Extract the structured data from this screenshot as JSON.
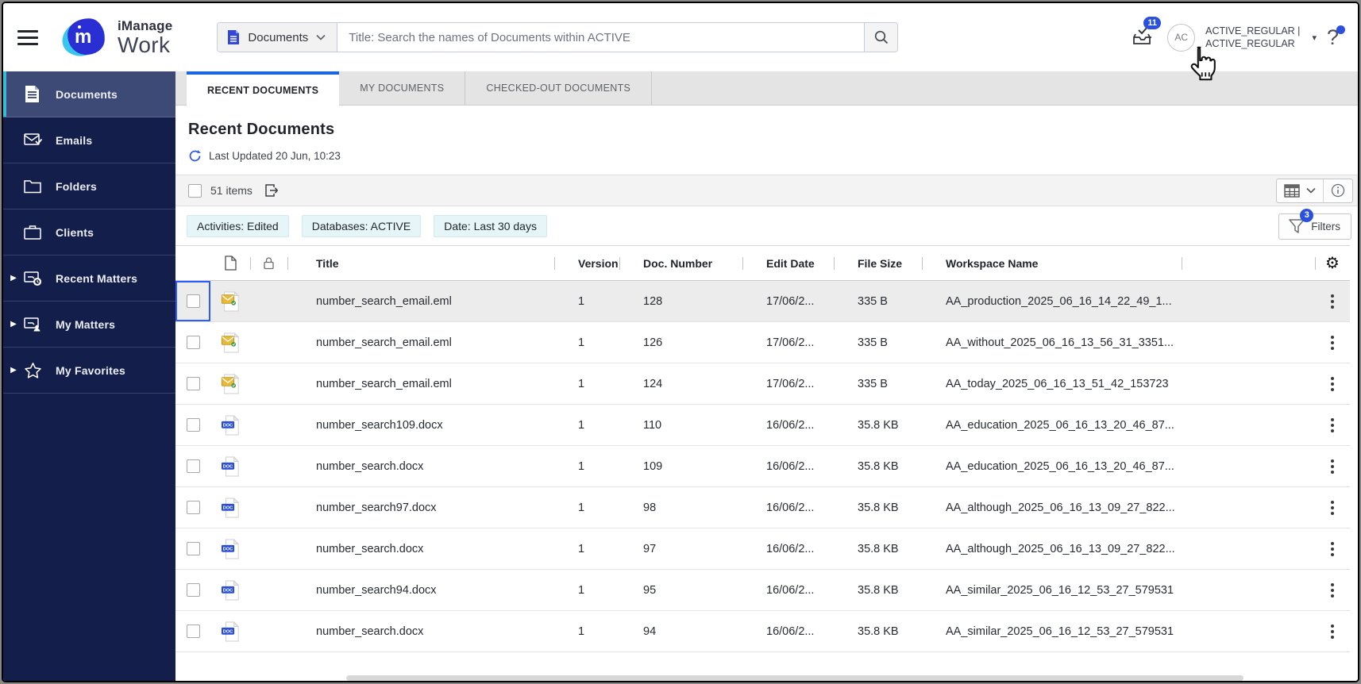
{
  "header": {
    "logo": {
      "line1": "iManage",
      "line2": "Work"
    },
    "search": {
      "scope": "Documents",
      "placeholder": "Title: Search the names of Documents within ACTIVE"
    },
    "notifications_count": "11",
    "user": {
      "initials": "AC",
      "line1": "ACTIVE_REGULAR |",
      "line2": "ACTIVE_REGULAR"
    },
    "help_glyph": "?"
  },
  "sidebar": {
    "items": [
      {
        "label": "Documents",
        "icon": "documents-icon",
        "active": true,
        "expandable": false
      },
      {
        "label": "Emails",
        "icon": "emails-icon",
        "active": false,
        "expandable": false
      },
      {
        "label": "Folders",
        "icon": "folders-icon",
        "active": false,
        "expandable": false
      },
      {
        "label": "Clients",
        "icon": "clients-icon",
        "active": false,
        "expandable": false
      },
      {
        "label": "Recent Matters",
        "icon": "recent-matters-icon",
        "active": false,
        "expandable": true
      },
      {
        "label": "My Matters",
        "icon": "my-matters-icon",
        "active": false,
        "expandable": true
      },
      {
        "label": "My Favorites",
        "icon": "favorites-star-icon",
        "active": false,
        "expandable": true
      }
    ]
  },
  "tabs": [
    {
      "label": "RECENT DOCUMENTS",
      "active": true
    },
    {
      "label": "MY DOCUMENTS",
      "active": false
    },
    {
      "label": "CHECKED-OUT DOCUMENTS",
      "active": false
    }
  ],
  "content": {
    "title": "Recent Documents",
    "last_updated": "Last Updated 20 Jun, 10:23",
    "items_count": "51 items",
    "filter_chips": [
      "Activities: Edited",
      "Databases: ACTIVE",
      "Date: Last 30 days"
    ],
    "filters": {
      "label": "Filters",
      "badge": "3"
    }
  },
  "table": {
    "columns": {
      "title": "Title",
      "version": "Version",
      "doc_number": "Doc. Number",
      "edit_date": "Edit Date",
      "file_size": "File Size",
      "workspace": "Workspace Name"
    },
    "rows": [
      {
        "type": "email",
        "title": "number_search_email.eml",
        "version": "1",
        "doc_number": "128",
        "edit_date": "17/06/2...",
        "file_size": "335 B",
        "workspace": "AA_production_2025_06_16_14_22_49_1...",
        "selected": true
      },
      {
        "type": "email",
        "title": "number_search_email.eml",
        "version": "1",
        "doc_number": "126",
        "edit_date": "17/06/2...",
        "file_size": "335 B",
        "workspace": "AA_without_2025_06_16_13_56_31_3351...",
        "selected": false
      },
      {
        "type": "email",
        "title": "number_search_email.eml",
        "version": "1",
        "doc_number": "124",
        "edit_date": "17/06/2...",
        "file_size": "335 B",
        "workspace": "AA_today_2025_06_16_13_51_42_153723",
        "selected": false
      },
      {
        "type": "doc",
        "title": "number_search109.docx",
        "version": "1",
        "doc_number": "110",
        "edit_date": "16/06/2...",
        "file_size": "35.8 KB",
        "workspace": "AA_education_2025_06_16_13_20_46_87...",
        "selected": false
      },
      {
        "type": "doc",
        "title": "number_search.docx",
        "version": "1",
        "doc_number": "109",
        "edit_date": "16/06/2...",
        "file_size": "35.8 KB",
        "workspace": "AA_education_2025_06_16_13_20_46_87...",
        "selected": false
      },
      {
        "type": "doc",
        "title": "number_search97.docx",
        "version": "1",
        "doc_number": "98",
        "edit_date": "16/06/2...",
        "file_size": "35.8 KB",
        "workspace": "AA_although_2025_06_16_13_09_27_822...",
        "selected": false
      },
      {
        "type": "doc",
        "title": "number_search.docx",
        "version": "1",
        "doc_number": "97",
        "edit_date": "16/06/2...",
        "file_size": "35.8 KB",
        "workspace": "AA_although_2025_06_16_13_09_27_822...",
        "selected": false
      },
      {
        "type": "doc",
        "title": "number_search94.docx",
        "version": "1",
        "doc_number": "95",
        "edit_date": "16/06/2...",
        "file_size": "35.8 KB",
        "workspace": "AA_similar_2025_06_16_12_53_27_579531",
        "selected": false
      },
      {
        "type": "doc",
        "title": "number_search.docx",
        "version": "1",
        "doc_number": "94",
        "edit_date": "16/06/2...",
        "file_size": "35.8 KB",
        "workspace": "AA_similar_2025_06_16_12_53_27_579531",
        "selected": false
      }
    ]
  },
  "colors": {
    "sidebar_navy": "#131e4a",
    "active_item": "#3e4a76",
    "accent_cyan": "#35bdd8",
    "tab_accent_blue": "#1a66e0",
    "badge_blue": "#2b50dd",
    "chip_bg": "#e6f5f8",
    "doc_icon_blue": "#2b4fd8",
    "email_icon_yellow": "#e9b938"
  }
}
